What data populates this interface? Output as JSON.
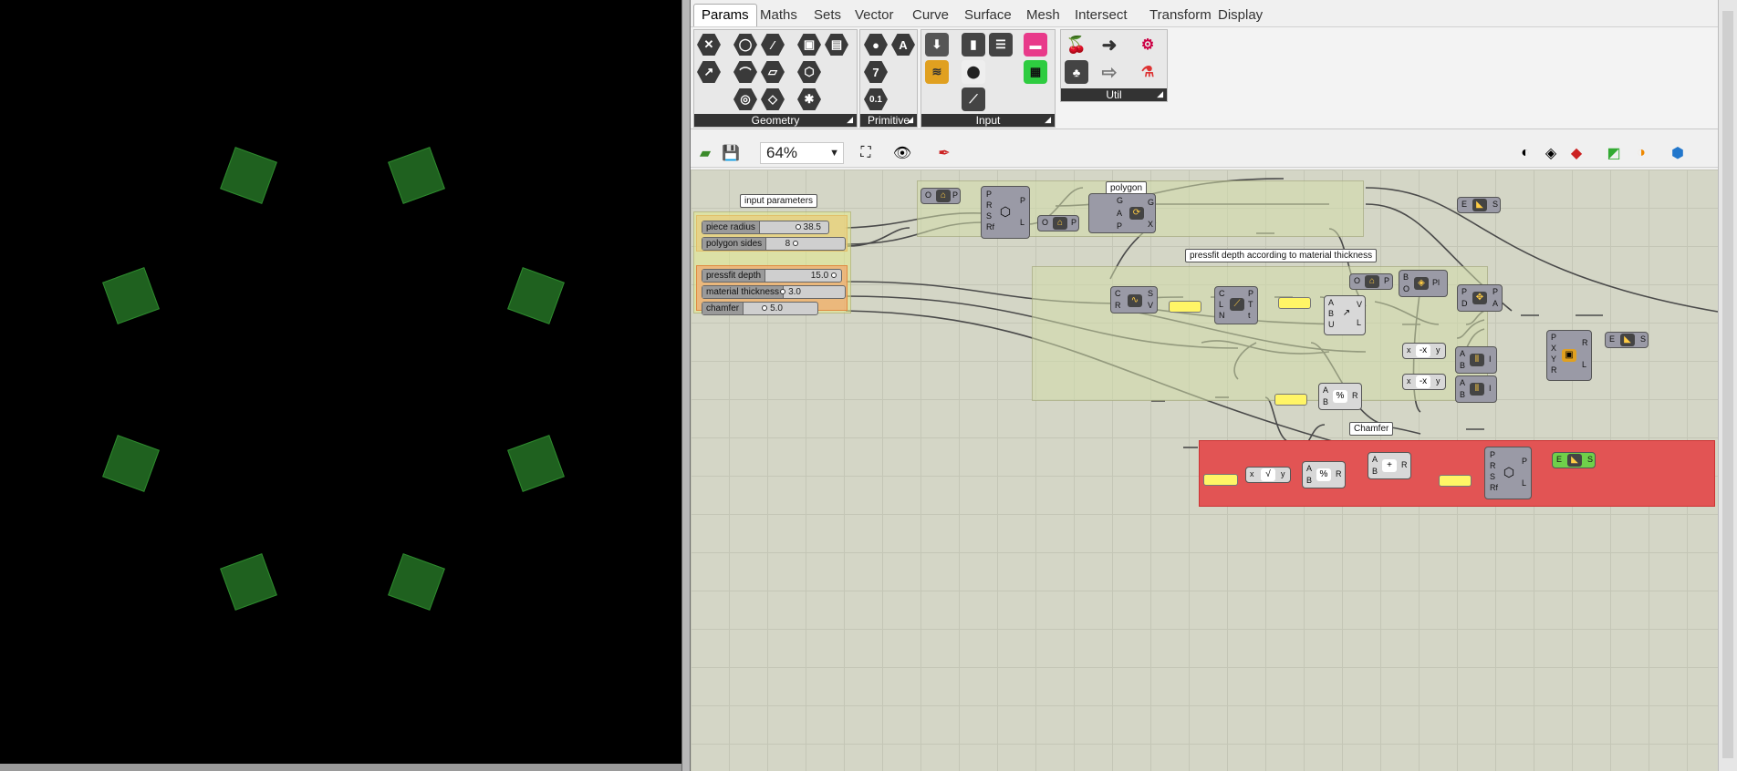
{
  "ribbon_tabs": [
    "Params",
    "Maths",
    "Sets",
    "Vector",
    "Curve",
    "Surface",
    "Mesh",
    "Intersect",
    "Transform",
    "Display"
  ],
  "ribbon_panels": {
    "geometry": "Geometry",
    "primitive": "Primitive",
    "input": "Input",
    "util": "Util"
  },
  "toolbar": {
    "zoom": "64%"
  },
  "canvas": {
    "groups": {
      "input_parameters": "input parameters",
      "polygon": "polygon",
      "pressfit": "pressfit depth according to material thickness",
      "chamfer": "Chamfer"
    },
    "sliders": [
      {
        "name": "piece radius",
        "value": "38.5"
      },
      {
        "name": "polygon sides",
        "value": "8"
      },
      {
        "name": "pressfit depth",
        "value": "15.0"
      },
      {
        "name": "material thickness",
        "value": "3.0"
      },
      {
        "name": "chamfer",
        "value": "5.0"
      }
    ]
  },
  "colors": {
    "viewport_square": "#1f611f",
    "group_green": "#d2dcaa",
    "group_orange": "#f0aa6e",
    "group_red": "#e25454",
    "panel_yellow": "#fff566"
  }
}
